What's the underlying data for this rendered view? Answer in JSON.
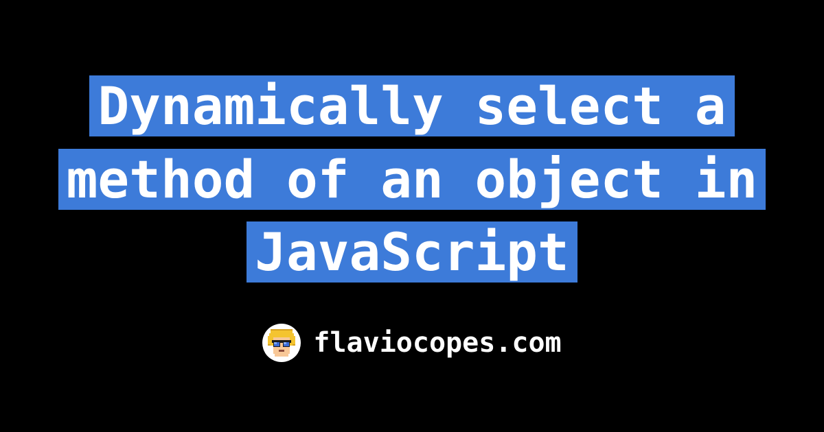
{
  "title": "Dynamically select a method of an object in JavaScript",
  "site": "flaviocopes.com",
  "colors": {
    "background": "#000000",
    "highlight": "#3d7bd9",
    "text": "#ffffff"
  }
}
